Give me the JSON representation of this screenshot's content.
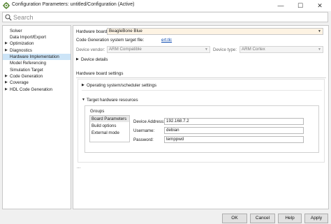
{
  "window": {
    "title": "Configuration Parameters: untitled/Configuration (Active)",
    "min_glyph": "—",
    "max_glyph": "☐",
    "close_glyph": "✕"
  },
  "search": {
    "placeholder": "Search"
  },
  "sidebar": {
    "items": [
      {
        "label": "Solver",
        "expandable": false
      },
      {
        "label": "Data Import/Export",
        "expandable": false
      },
      {
        "label": "Optimization",
        "expandable": true
      },
      {
        "label": "Diagnostics",
        "expandable": true
      },
      {
        "label": "Hardware Implementation",
        "expandable": false,
        "selected": true
      },
      {
        "label": "Model Referencing",
        "expandable": false
      },
      {
        "label": "Simulation Target",
        "expandable": false
      },
      {
        "label": "Code Generation",
        "expandable": true
      },
      {
        "label": "Coverage",
        "expandable": true
      },
      {
        "label": "HDL Code Generation",
        "expandable": true
      }
    ]
  },
  "main": {
    "hardware_board_label": "Hardware board:",
    "hardware_board_value": "BeagleBone Blue",
    "target_file_label": "Code Generation system target file:",
    "target_file_link": "ert.tlc",
    "device_vendor_label": "Device vendor:",
    "device_vendor_value": "ARM Compatible",
    "device_type_label": "Device type:",
    "device_type_value": "ARM Cortex",
    "device_details_label": "Device details",
    "board_settings_title": "Hardware board settings",
    "os_settings_label": "Operating system/scheduler settings",
    "target_resources_label": "Target hardware resources",
    "groups_label": "Groups",
    "groups": [
      "Board Parameters",
      "Build options",
      "External mode"
    ],
    "device_address_label": "Device Address:",
    "device_address_value": "192.168.7.2",
    "username_label": "Username:",
    "username_value": "debian",
    "password_label": "Password:",
    "password_value": "temppwd",
    "ellipsis": "..."
  },
  "buttons": {
    "ok": "OK",
    "cancel": "Cancel",
    "help": "Help",
    "apply": "Apply"
  },
  "colors": {
    "selection": "#cce4f7",
    "board_field": "#fdf3e3",
    "link": "#0645ad",
    "matlab_logo": "#e8743b"
  }
}
